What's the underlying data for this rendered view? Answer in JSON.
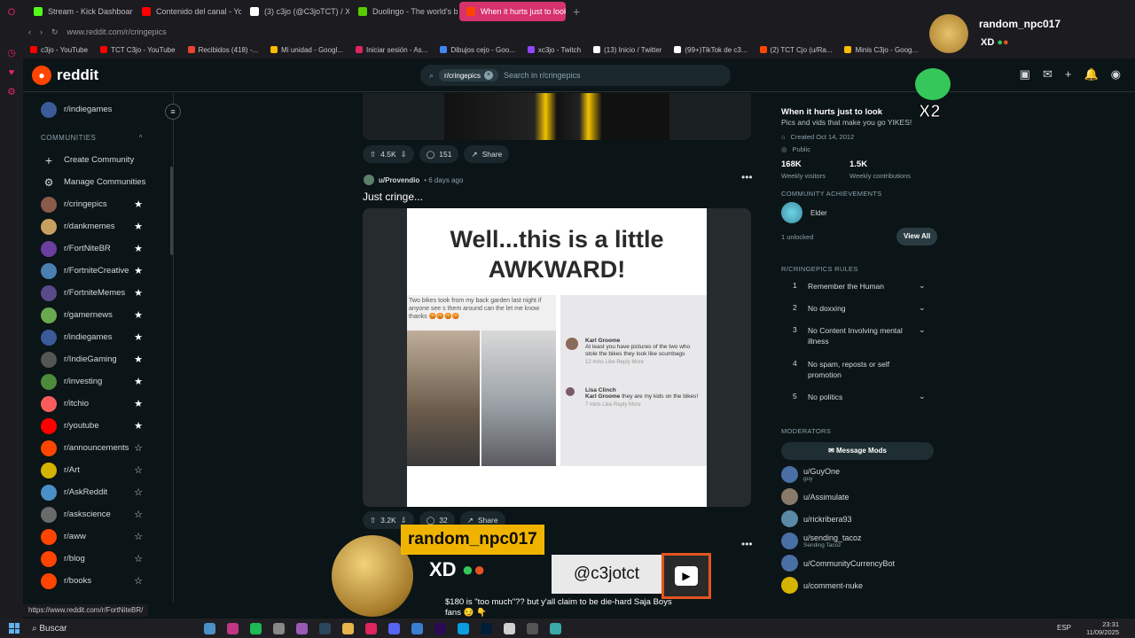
{
  "browser": {
    "tabs": [
      {
        "label": "Stream - Kick Dashboard",
        "color": "#53fc18"
      },
      {
        "label": "Contenido del canal - Yo",
        "color": "#ff0000"
      },
      {
        "label": "(3) c3jo (@C3joTCT) / X",
        "color": "#ffffff"
      },
      {
        "label": "Duolingo - The world's b",
        "color": "#58cc02"
      },
      {
        "label": "When it hurts just to look",
        "color": "#ff4500"
      }
    ],
    "url": "www.reddit.com/r/cringepics",
    "bookmarks": [
      {
        "label": "c3jo - YouTube",
        "color": "#ff0000"
      },
      {
        "label": "TCT C3jo - YouTube",
        "color": "#ff0000"
      },
      {
        "label": "Recibidos (418) -...",
        "color": "#ea4335"
      },
      {
        "label": "Mi unidad - Googl...",
        "color": "#fbbc04"
      },
      {
        "label": "Iniciar sesión - As...",
        "color": "#e0245e"
      },
      {
        "label": "Dibujos cejo - Goo...",
        "color": "#4285f4"
      },
      {
        "label": "xc3jo - Twitch",
        "color": "#9146ff"
      },
      {
        "label": "(13) Inicio / Twitter",
        "color": "#ffffff"
      },
      {
        "label": "(99+)TikTok de c3...",
        "color": "#ffffff"
      },
      {
        "label": "(2) TCT Cjo (u/Ra...",
        "color": "#ff4500"
      },
      {
        "label": "Minis C3jo - Goog...",
        "color": "#fbbc04"
      }
    ],
    "status_url": "https://www.reddit.com/r/FortNiteBR/"
  },
  "reddit": {
    "logo_text": "reddit",
    "search_chip": "r/cringepics",
    "search_placeholder": "Search in r/cringepics"
  },
  "sidebar": {
    "top_item": "r/indiegames",
    "section_label": "COMMUNITIES",
    "create_label": "Create Community",
    "manage_label": "Manage Communities",
    "communities": [
      {
        "name": "r/cringepics",
        "fav": true,
        "color": "#8a5a4a"
      },
      {
        "name": "r/dankmemes",
        "fav": true,
        "color": "#c8a060"
      },
      {
        "name": "r/FortNiteBR",
        "fav": true,
        "color": "#6a3fa0"
      },
      {
        "name": "r/FortniteCreative",
        "fav": true,
        "color": "#4a7fb0"
      },
      {
        "name": "r/FortniteMemes",
        "fav": true,
        "color": "#5a4a8a"
      },
      {
        "name": "r/gamernews",
        "fav": true,
        "color": "#6aa84f"
      },
      {
        "name": "r/indiegames",
        "fav": true,
        "color": "#3a5a9a"
      },
      {
        "name": "r/IndieGaming",
        "fav": true,
        "color": "#555555"
      },
      {
        "name": "r/investing",
        "fav": true,
        "color": "#4c8a3c"
      },
      {
        "name": "r/itchio",
        "fav": true,
        "color": "#fa5c5c"
      },
      {
        "name": "r/youtube",
        "fav": true,
        "color": "#ff0000"
      },
      {
        "name": "r/announcements",
        "fav": false,
        "color": "#ff4500"
      },
      {
        "name": "r/Art",
        "fav": false,
        "color": "#d4b400"
      },
      {
        "name": "r/AskReddit",
        "fav": false,
        "color": "#4a90c8"
      },
      {
        "name": "r/askscience",
        "fav": false,
        "color": "#6a6a6a"
      },
      {
        "name": "r/aww",
        "fav": false,
        "color": "#ff4500"
      },
      {
        "name": "r/blog",
        "fav": false,
        "color": "#ff4500"
      },
      {
        "name": "r/books",
        "fav": false,
        "color": "#ff4500"
      }
    ]
  },
  "feed": {
    "prev_post": {
      "upvotes": "4.5K",
      "comments": "151",
      "share": "Share"
    },
    "post": {
      "author": "u/Provendio",
      "time": "• 6 days ago",
      "title": "Just cringe...",
      "meme_headline_1": "Well...this is a little",
      "meme_headline_2": "AWKWARD!",
      "fb_text": "Two bikes took from my back garden last  night if anyone see s them around can the let me know  thanks 😡😡😡😡",
      "comment1": {
        "name": "Karl Groome",
        "text": "At least you have pictures of the two who stole the bikes they look like scumbags",
        "meta": "12 mins    Like    Reply    More"
      },
      "comment2": {
        "name": "Lisa Clinch",
        "reply_to": "Karl Groome",
        "text": "they are my kids on the bikes!",
        "meta": "7 mins    Like    Reply    More"
      },
      "upvotes": "3.2K",
      "comments": "32",
      "share": "Share"
    },
    "next_post_text": "$180 is \"too much\"?? but y'all claim to be die-hard Saja Boys fans 😏 👇"
  },
  "right_sidebar": {
    "title": "When it hurts just to look",
    "description": "Pics and vids that make you go YIKES!",
    "created": "Created Oct 14, 2012",
    "visibility": "Public",
    "visitors": "168K",
    "visitors_label": "Weekly visitors",
    "contributions": "1.5K",
    "contributions_label": "Weekly contributions",
    "achievements_header": "COMMUNITY ACHIEVEMENTS",
    "achievement": "Elder",
    "unlocked": "1 unlocked",
    "view_all": "View All",
    "rules_header": "R/CRINGEPICS RULES",
    "rules": [
      {
        "num": "1",
        "text": "Remember the Human"
      },
      {
        "num": "2",
        "text": "No doxxing"
      },
      {
        "num": "3",
        "text": "No Content Involving mental illness"
      },
      {
        "num": "4",
        "text": "No spam, reposts or self promotion"
      },
      {
        "num": "5",
        "text": "No politics"
      }
    ],
    "moderators_header": "MODERATORS",
    "message_mods": "Message Mods",
    "moderators": [
      {
        "name": "u/GuyOne",
        "sub": "guy"
      },
      {
        "name": "u/Assimulate",
        "sub": ""
      },
      {
        "name": "u/rickribera93",
        "sub": ""
      },
      {
        "name": "u/sending_tacoz",
        "sub": "Sending Tacoz"
      },
      {
        "name": "u/CommunityCurrencyBot",
        "sub": ""
      },
      {
        "name": "u/comment-nuke",
        "sub": ""
      }
    ]
  },
  "overlay": {
    "username": "random_npc017",
    "message": "XD",
    "handle": "@c3jotct",
    "multiplier": "X2"
  },
  "taskbar": {
    "search": "Buscar",
    "lang": "ESP",
    "time": "23:31",
    "date": "11/09/2025"
  }
}
